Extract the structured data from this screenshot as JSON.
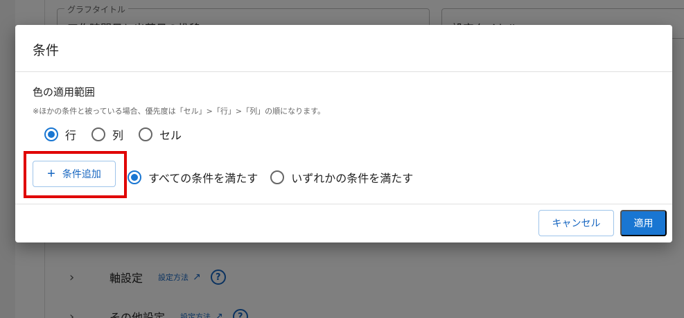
{
  "background": {
    "graph_title_field": {
      "legend": "グラフタイトル",
      "value": "工作時間日と出荷日の推移"
    },
    "second_field": {
      "value": "設定タイトル"
    },
    "rows": [
      {
        "label": "軸設定",
        "help": "設定方法",
        "ext_icon": "external-link-icon",
        "question": "?"
      },
      {
        "label": "その他設定",
        "help": "設定方法",
        "ext_icon": "external-link-icon",
        "question": "?"
      }
    ],
    "chevron": "›"
  },
  "dialog": {
    "title": "条件",
    "section_title": "色の適用範囲",
    "note": "※ほかの条件と被っている場合、優先度は「セル」>「行」>「列」の順になります。",
    "scope_options": [
      {
        "label": "行",
        "selected": true
      },
      {
        "label": "列",
        "selected": false
      },
      {
        "label": "セル",
        "selected": false
      }
    ],
    "add_condition": {
      "icon": "+",
      "label": "条件追加"
    },
    "match_options": [
      {
        "label": "すべての条件を満たす",
        "selected": true
      },
      {
        "label": "いずれかの条件を満たす",
        "selected": false
      }
    ],
    "cancel_label": "キャンセル",
    "apply_label": "適用"
  },
  "colors": {
    "accent": "#1976d2",
    "highlight": "#e00000"
  }
}
